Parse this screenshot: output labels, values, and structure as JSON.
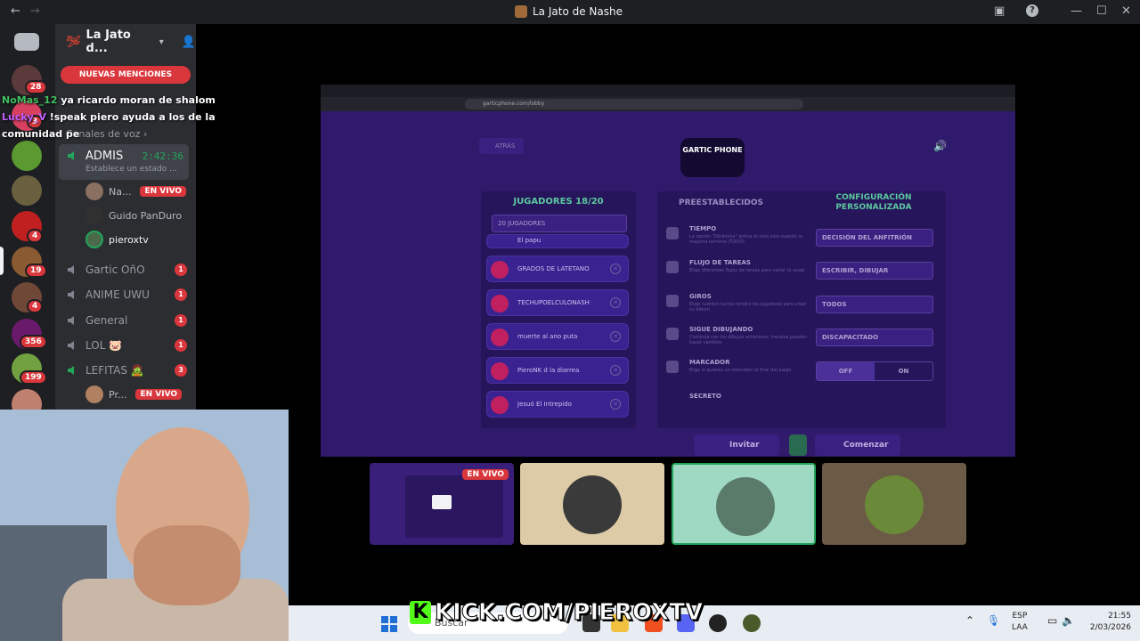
{
  "window": {
    "title": "La Jato de Nashe",
    "back": "←",
    "forward": "→",
    "minimize": "—",
    "maximize": "☐",
    "close": "✕",
    "help": "?"
  },
  "server_rail": {
    "badges": [
      "28",
      "3",
      "4",
      "19",
      "4",
      "356",
      "199"
    ]
  },
  "server": {
    "name": "La Jato d...",
    "new_mentions": "NUEVAS MENCIONES",
    "voice_category": "Canales de voz"
  },
  "voice_channel_active": {
    "name": "ADMIS",
    "timer": "2:42:36",
    "status": "Establece un estado ..."
  },
  "voice_users": [
    {
      "name": "Na...",
      "live": "EN VIVO"
    },
    {
      "name": "Guido PanDuro",
      "live": ""
    },
    {
      "name": "pieroxtv",
      "live": ""
    }
  ],
  "channels": [
    {
      "name": "Gartic OñO",
      "count": "1"
    },
    {
      "name": "ANIME UWU",
      "count": "1"
    },
    {
      "name": "General",
      "count": "1"
    },
    {
      "name": "LOL 🐷",
      "count": "1"
    },
    {
      "name": "LEFITAS 🧟",
      "count": "3"
    }
  ],
  "lefitas_user": {
    "name": "Pr...",
    "live": "EN VIVO"
  },
  "chat": [
    {
      "user": "NoMas_12",
      "text": "ya ricardo moran de shalom"
    },
    {
      "user": "Lucky_V",
      "text": "!speak piero ayuda a los de la comunidad pe"
    }
  ],
  "stream": {
    "url": "garticphone.com/lobby",
    "back_label": "ATRÁS",
    "logo": "GARTIC PHONE",
    "players_header": "JUGADORES 18/20",
    "players_select": "20 JUGADORES",
    "players": [
      "El papu",
      "GRADOS DE LATETANO",
      "TECHUPOELCULONASH",
      "muerte al ano puta",
      "PieroNK d la diarrea",
      "Jesuó El Intrepido"
    ],
    "presets_header": "PREESTABLECIDOS",
    "custom_header": "CONFIGURACIÓN PERSONALIZADA",
    "options": [
      {
        "title": "TIEMPO",
        "desc": "La opción \"Dinámica\" activa el reloj solo cuando la mayoría termine (TODO)",
        "value": "DECISIÓN DEL ANFITRIÓN"
      },
      {
        "title": "FLUJO DE TAREAS",
        "desc": "Elige diferentes flujos de tareas para variar lo usual",
        "value": "ESCRIBIR, DIBUJAR"
      },
      {
        "title": "GIROS",
        "desc": "Elige cuántos turnos tendrá los jugadores para crear su álbum",
        "value": "TODOS"
      },
      {
        "title": "SIGUE DIBUJANDO",
        "desc": "Continúa con los dibujos anteriores, tracelos pueden hacer cambios",
        "value": "DISCAPACITADO"
      },
      {
        "title": "MARCADOR",
        "desc": "Elige si quieres un marcador al final del juego",
        "value": ""
      },
      {
        "title": "SECRETO",
        "desc": "",
        "value": ""
      }
    ],
    "toggle_off": "OFF",
    "toggle_on": "ON",
    "invite": "Invitar",
    "start": "Comenzar"
  },
  "tiles": [
    {
      "live": "EN VIVO",
      "color": "#3a1f7a"
    },
    {
      "live": "",
      "color": "#dccba6"
    },
    {
      "live": "",
      "color": "#9fd8c3"
    },
    {
      "live": "",
      "color": "#6b5a45"
    }
  ],
  "taskbar": {
    "search": "Buscar",
    "lang": "ESP",
    "lang2": "LAA",
    "time": "21:55",
    "date": "2/03/2026"
  },
  "overlay": {
    "k": "K",
    "brand": "KICK.COM/PIEROXTV"
  }
}
